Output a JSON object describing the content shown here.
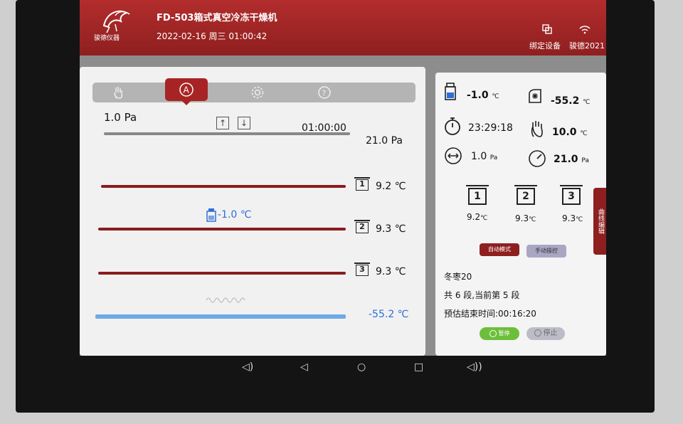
{
  "header": {
    "title": "FD-503箱式真空冷冻干燥机",
    "datetime": "2022-02-16 周三 01:00:42",
    "brand": "骏德仪器",
    "bind_device_label": "绑定设备",
    "wifi_label": "骏德2021"
  },
  "tabs": [
    {
      "icon": "hand-icon"
    },
    {
      "icon": "auto-mode-icon",
      "active": true
    },
    {
      "icon": "gear-icon"
    },
    {
      "icon": "help-icon"
    }
  ],
  "left": {
    "vacuum_set": "1.0 Pa",
    "timer": "01:00:00",
    "vacuum_limit": "21.0 Pa",
    "sample_temp": "-1.0 ℃",
    "shelves": [
      {
        "id": "1",
        "temp": "9.2 ℃"
      },
      {
        "id": "2",
        "temp": "9.3 ℃"
      },
      {
        "id": "3",
        "temp": "9.3 ℃"
      }
    ],
    "cold_trap_temp": "-55.2 ℃"
  },
  "right": {
    "sample_temp_value": "-1.0",
    "sample_temp_unit": "℃",
    "cold_trap_value": "-55.2",
    "cold_trap_unit": "℃",
    "time_remaining": "23:29:18",
    "heat_value": "10.0",
    "heat_unit": "℃",
    "vacuum_value": "1.0",
    "vacuum_unit": "Pa",
    "pressure_value": "21.0",
    "pressure_unit": "Pa",
    "shelves": [
      {
        "id": "1",
        "temp": "9.2",
        "unit": "℃"
      },
      {
        "id": "2",
        "temp": "9.3",
        "unit": "℃"
      },
      {
        "id": "3",
        "temp": "9.3",
        "unit": "℃"
      }
    ],
    "auto_mode_label": "自动模式",
    "manual_label": "手动操控",
    "program_name": "冬枣20",
    "segment_info": "共 6 段,当前第 5 段",
    "eta": "预估结束时间:00:16:20",
    "pause_label": "暂停",
    "stop_label": "停止",
    "side_tab_label": "曲线编辑"
  },
  "colors": {
    "header_red": "#a82424",
    "value_blue": "#2d6fd6",
    "pause_green": "#6cbf3a"
  }
}
